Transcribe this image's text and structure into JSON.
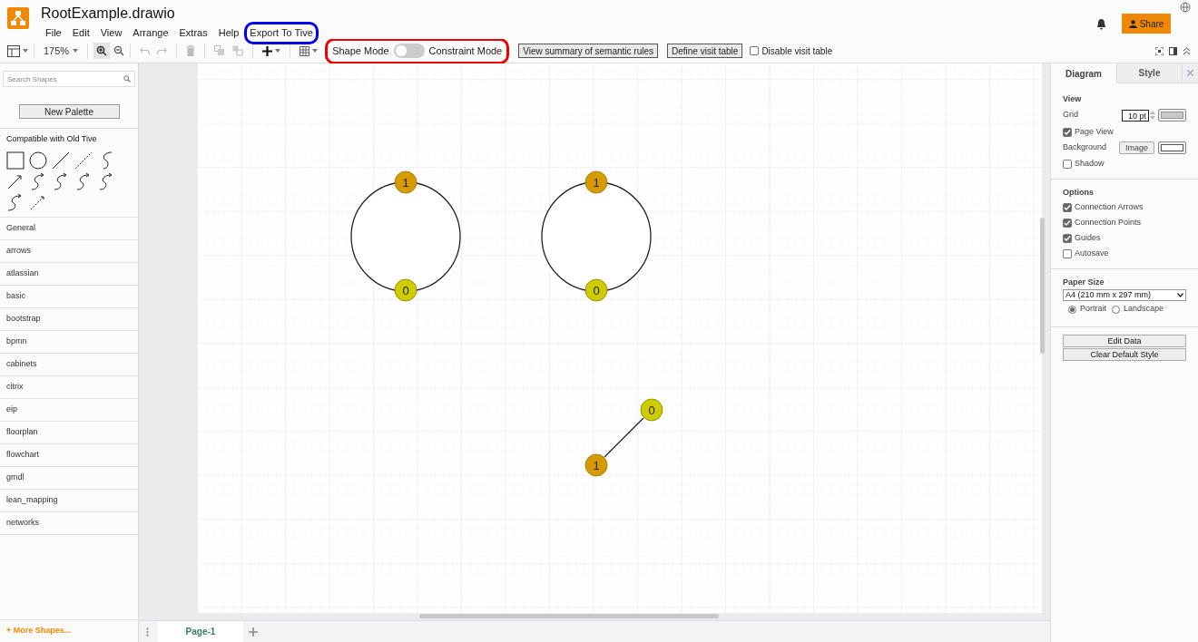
{
  "app": {
    "title": "RootExample.drawio",
    "share": "Share"
  },
  "menu": [
    {
      "label": "File",
      "circled": false
    },
    {
      "label": "Edit",
      "circled": false
    },
    {
      "label": "View",
      "circled": false
    },
    {
      "label": "Arrange",
      "circled": false
    },
    {
      "label": "Extras",
      "circled": false
    },
    {
      "label": "Help",
      "circled": false
    },
    {
      "label": "Export To Tive",
      "circled": true,
      "color": "#0000ee"
    }
  ],
  "toolbar": {
    "zoom": "175%",
    "mode_toggle": {
      "left_label": "Shape Mode",
      "right_label": "Constraint Mode",
      "on": false,
      "circled": true,
      "color": "#ee0000"
    },
    "buttons": [
      "View summary of semantic rules",
      "Define visit table"
    ],
    "checkbox": {
      "label": "Disable visit table",
      "checked": false
    }
  },
  "sidebar": {
    "search": {
      "placeholder": "Search Shapes"
    },
    "new_palette": "New Palette",
    "sections": [
      {
        "label": "Compatible with Old Tive",
        "expanded": true
      },
      {
        "label": "General",
        "expanded": false
      },
      {
        "label": "arrows",
        "expanded": false
      },
      {
        "label": "atlassian",
        "expanded": false
      },
      {
        "label": "basic",
        "expanded": false
      },
      {
        "label": "bootstrap",
        "expanded": false
      },
      {
        "label": "bpmn",
        "expanded": false
      },
      {
        "label": "cabinets",
        "expanded": false
      },
      {
        "label": "citrix",
        "expanded": false
      },
      {
        "label": "eip",
        "expanded": false
      },
      {
        "label": "floorplan",
        "expanded": false
      },
      {
        "label": "flowchart",
        "expanded": false
      },
      {
        "label": "gmdl",
        "expanded": false
      },
      {
        "label": "lean_mapping",
        "expanded": false
      },
      {
        "label": "networks",
        "expanded": false
      }
    ],
    "more_shapes": "+ More Shapes..."
  },
  "diagram": {
    "nodes": [
      {
        "kind": "circle",
        "ports": [
          {
            "label": "1",
            "color": "#d79b00"
          },
          {
            "label": "0",
            "color": "#cccc00"
          }
        ]
      },
      {
        "kind": "circle",
        "ports": [
          {
            "label": "1",
            "color": "#d79b00"
          },
          {
            "label": "0",
            "color": "#cccc00"
          }
        ]
      },
      {
        "kind": "edge",
        "ports": [
          {
            "label": "0",
            "color": "#cccc00"
          },
          {
            "label": "1",
            "color": "#d79b00"
          }
        ]
      }
    ]
  },
  "pages": [
    {
      "label": "Page-1",
      "selected": true
    }
  ],
  "format_panel": {
    "tabs": [
      {
        "label": "Diagram",
        "selected": true
      },
      {
        "label": "Style",
        "selected": false
      }
    ],
    "view": {
      "heading": "View",
      "grid_label": "Grid",
      "grid_value": "10 pt",
      "checks": [
        {
          "label": "Page View",
          "checked": true
        }
      ],
      "background_label": "Background",
      "image_button": "Image",
      "checks2": [
        {
          "label": "Shadow",
          "checked": false
        }
      ]
    },
    "options": {
      "heading": "Options",
      "checks": [
        {
          "label": "Connection Arrows",
          "checked": true
        },
        {
          "label": "Connection Points",
          "checked": true
        },
        {
          "label": "Guides",
          "checked": true
        },
        {
          "label": "Autosave",
          "checked": false
        }
      ]
    },
    "paper": {
      "heading": "Paper Size",
      "value": "A4 (210 mm x 297 mm)",
      "orientations": [
        {
          "label": "Portrait",
          "selected": true
        },
        {
          "label": "Landscape",
          "selected": false
        }
      ]
    },
    "buttons": [
      "Edit Data",
      "Clear Default Style"
    ]
  }
}
